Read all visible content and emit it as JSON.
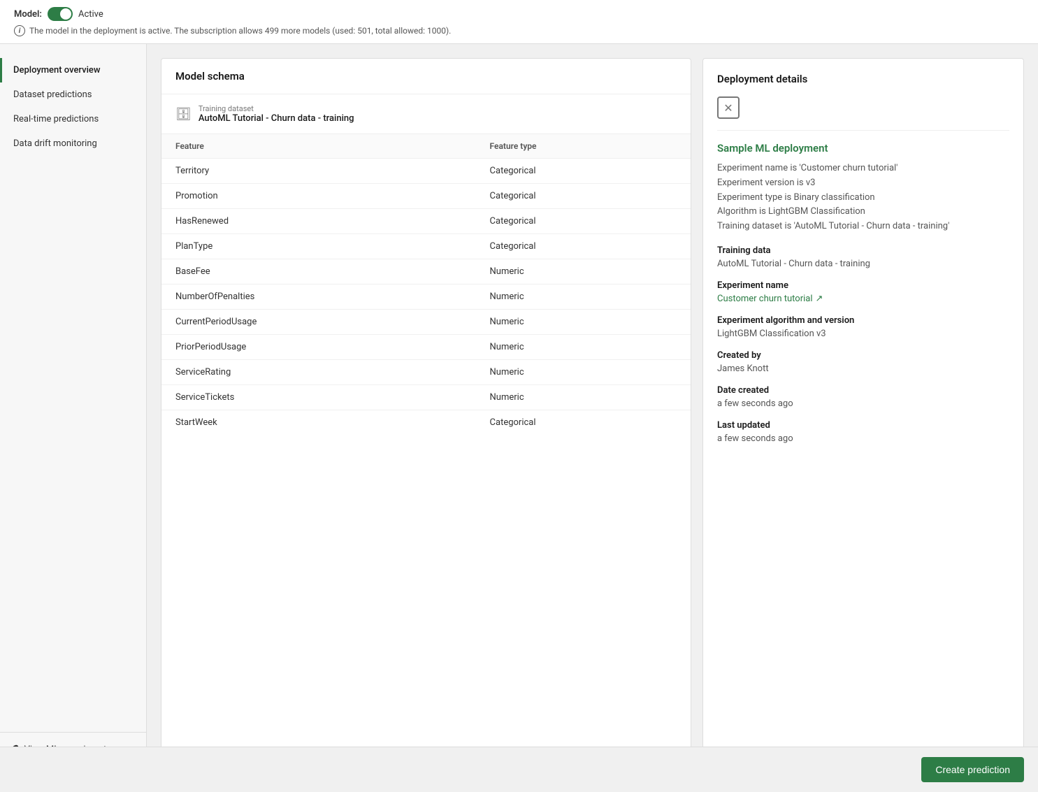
{
  "topBar": {
    "modelLabel": "Model:",
    "modelStatus": "Active",
    "infoText": "The model in the deployment is active. The subscription allows 499 more models (used: 501, total allowed: 1000)."
  },
  "sidebar": {
    "items": [
      {
        "id": "deployment-overview",
        "label": "Deployment overview",
        "active": true
      },
      {
        "id": "dataset-predictions",
        "label": "Dataset predictions",
        "active": false
      },
      {
        "id": "realtime-predictions",
        "label": "Real-time predictions",
        "active": false
      },
      {
        "id": "data-drift",
        "label": "Data drift monitoring",
        "active": false
      }
    ],
    "viewMLLabel": "View ML experiment",
    "viewMLLinkIcon": "↗"
  },
  "schemaPanel": {
    "title": "Model schema",
    "trainingDataset": {
      "label": "Training dataset",
      "name": "AutoML Tutorial - Churn data - training"
    },
    "columns": [
      {
        "header": "Feature",
        "key": "feature"
      },
      {
        "header": "Feature type",
        "key": "type"
      }
    ],
    "rows": [
      {
        "feature": "Territory",
        "type": "Categorical"
      },
      {
        "feature": "Promotion",
        "type": "Categorical"
      },
      {
        "feature": "HasRenewed",
        "type": "Categorical"
      },
      {
        "feature": "PlanType",
        "type": "Categorical"
      },
      {
        "feature": "BaseFee",
        "type": "Numeric"
      },
      {
        "feature": "NumberOfPenalties",
        "type": "Numeric"
      },
      {
        "feature": "CurrentPeriodUsage",
        "type": "Numeric"
      },
      {
        "feature": "PriorPeriodUsage",
        "type": "Numeric"
      },
      {
        "feature": "ServiceRating",
        "type": "Numeric"
      },
      {
        "feature": "ServiceTickets",
        "type": "Numeric"
      },
      {
        "feature": "StartWeek",
        "type": "Categorical"
      }
    ]
  },
  "detailsPanel": {
    "title": "Deployment details",
    "deploymentName": "Sample ML deployment",
    "metaLines": [
      "Experiment name is 'Customer churn tutorial'",
      "Experiment version is v3",
      "Experiment type is Binary classification",
      "Algorithm is LightGBM Classification",
      "Training dataset is 'AutoML Tutorial - Churn data - training'"
    ],
    "sections": [
      {
        "title": "Training data",
        "value": "AutoML Tutorial - Churn data - training",
        "isLink": false
      },
      {
        "title": "Experiment name",
        "value": "Customer churn tutorial",
        "isLink": true
      },
      {
        "title": "Experiment algorithm and version",
        "value": "LightGBM Classification v3",
        "isLink": false
      },
      {
        "title": "Created by",
        "value": "James Knott",
        "isLink": false
      },
      {
        "title": "Date created",
        "value": "a few seconds ago",
        "isLink": false
      },
      {
        "title": "Last updated",
        "value": "a few seconds ago",
        "isLink": false
      }
    ]
  },
  "bottomBar": {
    "createPredictionLabel": "Create prediction"
  }
}
